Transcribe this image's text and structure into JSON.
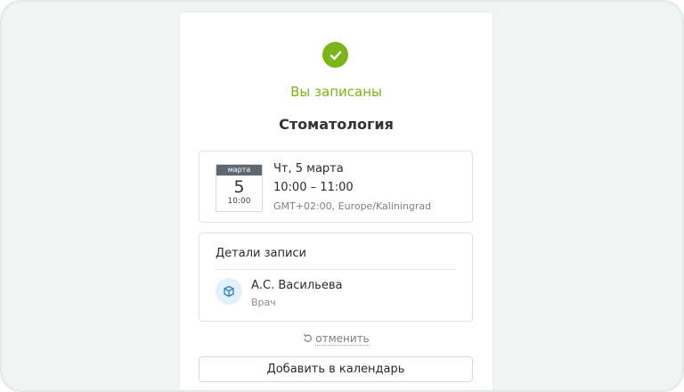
{
  "booking": {
    "status": "Вы записаны",
    "service": "Стоматология"
  },
  "date_block": {
    "calendar_month": "марта",
    "calendar_day": "5",
    "calendar_time": "10:00",
    "date": "Чт, 5 марта",
    "time_range": "10:00 – 11:00",
    "timezone": "GMT+02:00, Europe/Kaliningrad"
  },
  "details": {
    "title": "Детали записи",
    "doctor_name": "А.С. Васильева",
    "doctor_role": "Врач",
    "doctor_icon": "cube-icon"
  },
  "actions": {
    "cancel_label": "отменить",
    "cancel_icon": "undo-icon",
    "add_to_calendar_label": "Добавить в календарь"
  },
  "colors": {
    "accent_green": "#7cb518",
    "calendar_header": "#5d6870",
    "icon_bg": "#e3f1fb",
    "icon_blue": "#2a7fc0"
  }
}
